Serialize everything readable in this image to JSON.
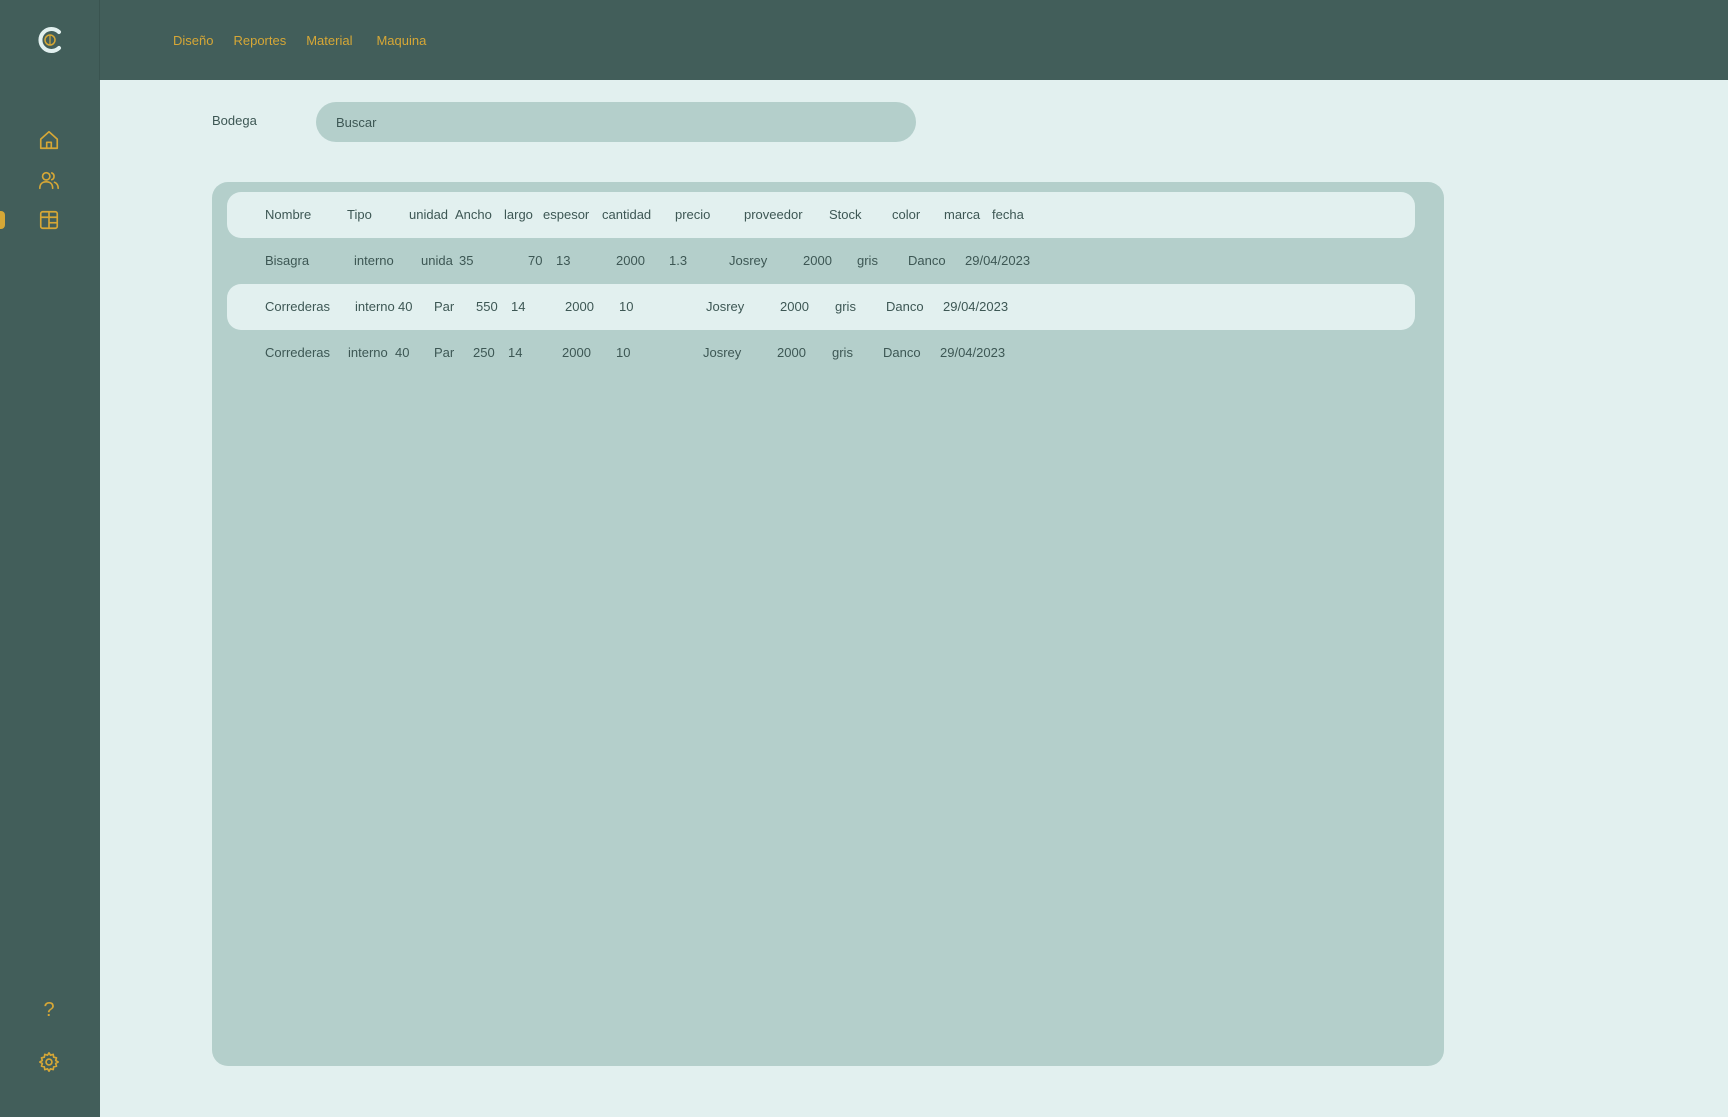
{
  "header": {
    "logo_letter": "C",
    "nav": [
      "Diseño",
      "Reportes",
      "Material",
      "Maquina"
    ]
  },
  "sidebar": {
    "icons": [
      "home-icon",
      "users-icon",
      "store-icon",
      "help-icon",
      "gear-icon"
    ],
    "active": "store-icon",
    "help_glyph": "?"
  },
  "colors": {
    "accent": "#d6a736",
    "dark": "#425e5a",
    "panel": "#b4cfcb",
    "background": "#e2f0ef"
  },
  "toolbar": {
    "section_label": "Bodega",
    "search_placeholder": "Buscar"
  },
  "table": {
    "headers": [
      "Nombre",
      "Tipo",
      "unidad",
      "Ancho",
      "largo",
      "espesor",
      "cantidad",
      "precio",
      "proveedor",
      "Stock",
      "color",
      "marca",
      "fecha"
    ],
    "rows": [
      [
        "Bisagra",
        "interno",
        "unida",
        "35",
        "70",
        "13",
        "2000",
        "1.3",
        "Josrey",
        "2000",
        "gris",
        "Danco",
        "29/04/2023"
      ],
      [
        "Correderas",
        "interno",
        "40",
        "Par",
        "550",
        "14",
        "2000",
        "10",
        "Josrey",
        "2000",
        "gris",
        "Danco",
        "29/04/2023"
      ],
      [
        "Correderas",
        "interno",
        "40",
        "Par",
        "250",
        "14",
        "2000",
        "10",
        "Josrey",
        "2000",
        "gris",
        "Danco",
        "29/04/2023"
      ]
    ]
  }
}
